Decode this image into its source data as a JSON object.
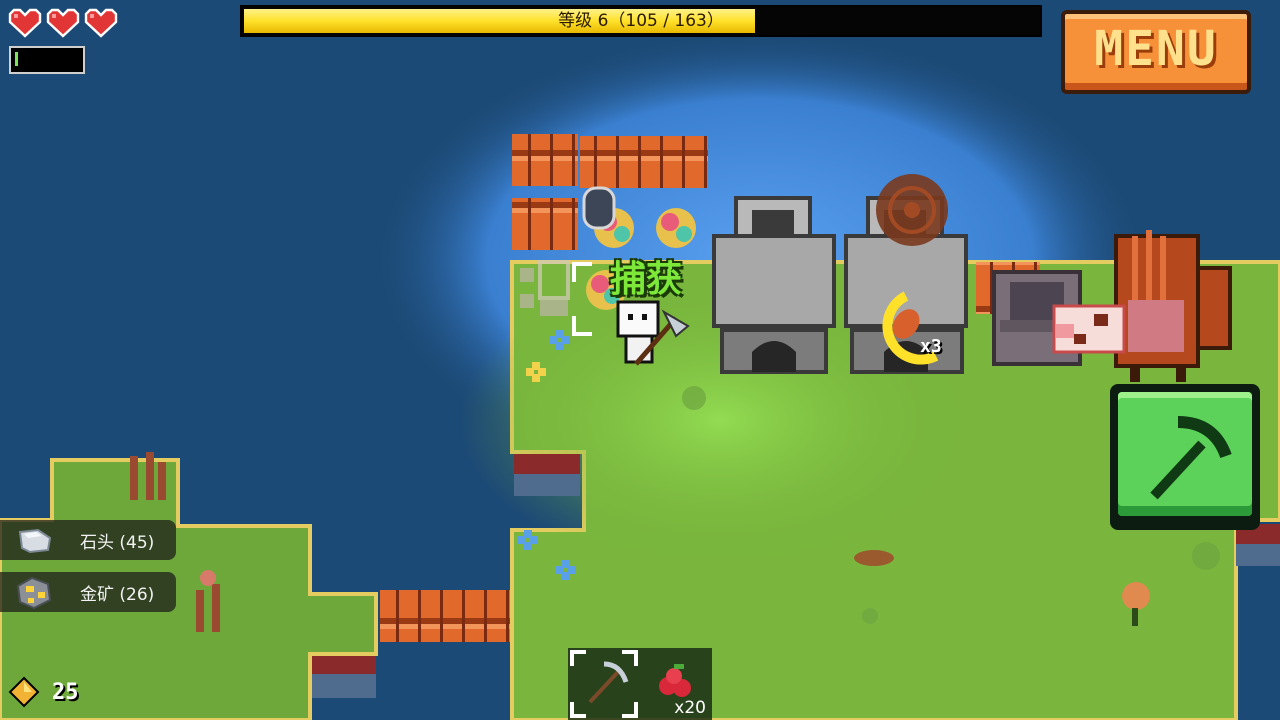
{
  "hud": {
    "hearts": 3,
    "stamina_fraction": 0.03,
    "level_text": "等级 6（105 / 163）",
    "xp_current": 105,
    "xp_max": 163,
    "menu_label": "MENU",
    "gems": "25"
  },
  "resources": [
    {
      "label": "石头 (45)",
      "icon": "stone-icon"
    },
    {
      "label": "金矿 (26)",
      "icon": "gold-ore-icon"
    }
  ],
  "world": {
    "capture_label": "捕获",
    "loot_count": "x3"
  },
  "hotbar": {
    "slots": [
      {
        "icon": "pickaxe-icon",
        "selected": true
      },
      {
        "icon": "berries-icon",
        "count": "x20"
      }
    ]
  },
  "action_button": {
    "icon": "pickaxe-icon"
  },
  "colors": {
    "water": "#1c4a76",
    "shallow_water": "#3e83d4",
    "grass": "#7ec240",
    "xp_fill": "#ffe12a",
    "menu_bg": "#f6913a",
    "tool_button": "#5dd25a"
  }
}
